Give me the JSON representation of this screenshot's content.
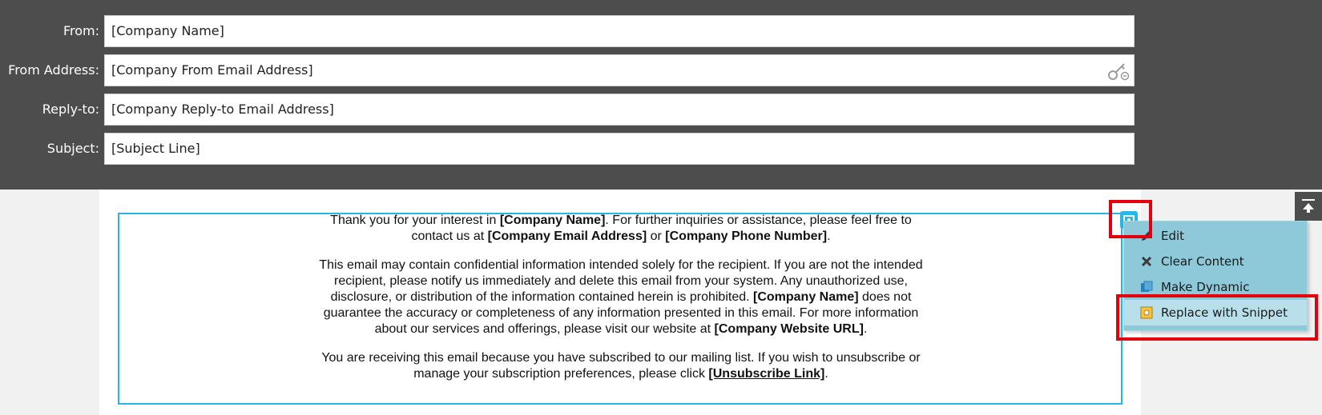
{
  "header": {
    "fields": [
      {
        "label": "From:",
        "value": "[Company Name]"
      },
      {
        "label": "From Address:",
        "value": "[Company From Email Address]"
      },
      {
        "label": "Reply-to:",
        "value": "[Company Reply-to Email Address]"
      },
      {
        "label": "Subject:",
        "value": "[Subject Line]"
      }
    ],
    "token_icon": "token-key-icon"
  },
  "email": {
    "p1_a": "Thank you for your interest in ",
    "p1_b": "[Company Name]",
    "p1_c": ". For further inquiries or assistance, please feel free to contact us at ",
    "p1_d": "[Company Email Address]",
    "p1_e": " or ",
    "p1_f": "[Company Phone Number]",
    "p1_g": ".",
    "p2_a": "This email may contain confidential information intended solely for the recipient. If you are not the intended recipient, please notify us immediately and delete this email from your system. Any unauthorized use, disclosure, or distribution of the information contained herein is prohibited. ",
    "p2_b": "[Company Name]",
    "p2_c": " does not guarantee the accuracy or completeness of any information presented in this email. For more information about our services and offerings, please visit our website at ",
    "p2_d": "[Company Website URL]",
    "p2_e": ".",
    "p3_a": "You are receiving this email because you have subscribed to our mailing list. If you wish to unsubscribe or manage your subscription preferences, please click ",
    "p3_b": "[Unsubscribe Link]",
    "p3_c": "."
  },
  "context_menu": {
    "items": [
      {
        "label": "Edit",
        "icon": "pencil-icon"
      },
      {
        "label": "Clear Content",
        "icon": "x-icon"
      },
      {
        "label": "Make Dynamic",
        "icon": "dynamic-icon"
      },
      {
        "label": "Replace with Snippet",
        "icon": "snippet-icon"
      }
    ]
  },
  "colors": {
    "header_bg": "#4d4d4d",
    "accent_blue": "#29b6e6",
    "menu_bg": "#8dc9d8",
    "highlight_red": "#e3000b"
  }
}
